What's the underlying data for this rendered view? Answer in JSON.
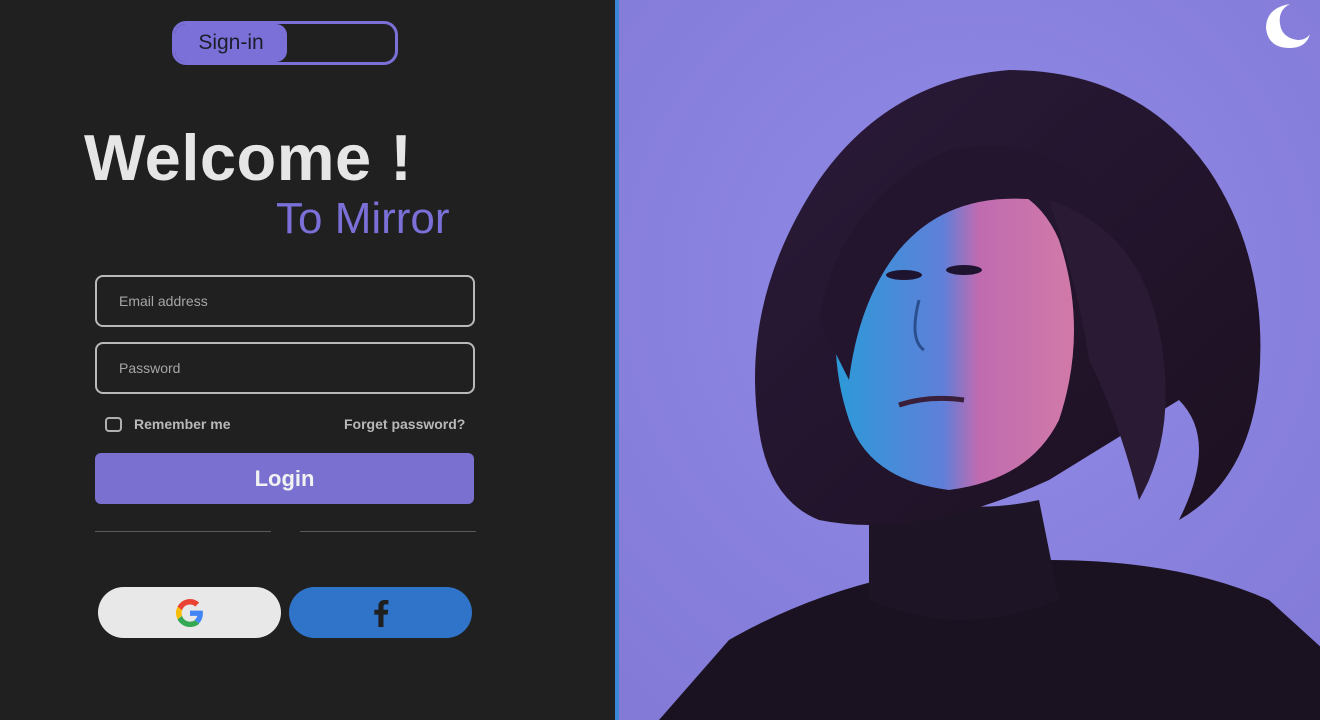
{
  "toggle": {
    "label": "Sign-in"
  },
  "heading": {
    "title": "Welcome !",
    "subtitle": "To Mirror"
  },
  "form": {
    "email_placeholder": "Email address",
    "password_placeholder": "Password",
    "remember_label": "Remember me",
    "forget_label": "Forget password?",
    "login_label": "Login"
  },
  "social": {
    "google_icon": "google-icon",
    "facebook_icon": "facebook-icon"
  },
  "theme": {
    "icon": "moon-icon"
  },
  "colors": {
    "accent": "#7a70d8",
    "background": "#202020",
    "facebook": "#2f74c8",
    "google_button": "#e8e8e8"
  }
}
